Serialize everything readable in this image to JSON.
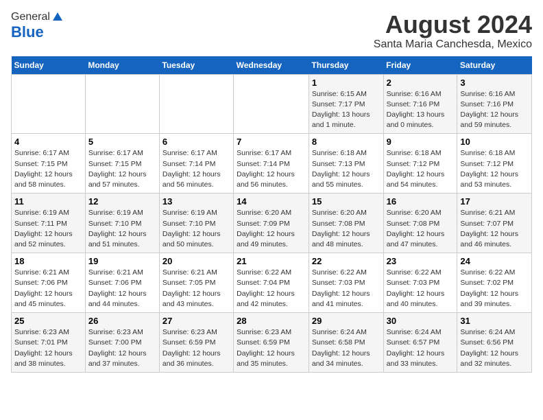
{
  "header": {
    "logo_general": "General",
    "logo_blue": "Blue",
    "month_year": "August 2024",
    "location": "Santa Maria Canchesda, Mexico"
  },
  "days_of_week": [
    "Sunday",
    "Monday",
    "Tuesday",
    "Wednesday",
    "Thursday",
    "Friday",
    "Saturday"
  ],
  "weeks": [
    [
      {
        "day": "",
        "info": ""
      },
      {
        "day": "",
        "info": ""
      },
      {
        "day": "",
        "info": ""
      },
      {
        "day": "",
        "info": ""
      },
      {
        "day": "1",
        "info": "Sunrise: 6:15 AM\nSunset: 7:17 PM\nDaylight: 13 hours\nand 1 minute."
      },
      {
        "day": "2",
        "info": "Sunrise: 6:16 AM\nSunset: 7:16 PM\nDaylight: 13 hours\nand 0 minutes."
      },
      {
        "day": "3",
        "info": "Sunrise: 6:16 AM\nSunset: 7:16 PM\nDaylight: 12 hours\nand 59 minutes."
      }
    ],
    [
      {
        "day": "4",
        "info": "Sunrise: 6:17 AM\nSunset: 7:15 PM\nDaylight: 12 hours\nand 58 minutes."
      },
      {
        "day": "5",
        "info": "Sunrise: 6:17 AM\nSunset: 7:15 PM\nDaylight: 12 hours\nand 57 minutes."
      },
      {
        "day": "6",
        "info": "Sunrise: 6:17 AM\nSunset: 7:14 PM\nDaylight: 12 hours\nand 56 minutes."
      },
      {
        "day": "7",
        "info": "Sunrise: 6:17 AM\nSunset: 7:14 PM\nDaylight: 12 hours\nand 56 minutes."
      },
      {
        "day": "8",
        "info": "Sunrise: 6:18 AM\nSunset: 7:13 PM\nDaylight: 12 hours\nand 55 minutes."
      },
      {
        "day": "9",
        "info": "Sunrise: 6:18 AM\nSunset: 7:12 PM\nDaylight: 12 hours\nand 54 minutes."
      },
      {
        "day": "10",
        "info": "Sunrise: 6:18 AM\nSunset: 7:12 PM\nDaylight: 12 hours\nand 53 minutes."
      }
    ],
    [
      {
        "day": "11",
        "info": "Sunrise: 6:19 AM\nSunset: 7:11 PM\nDaylight: 12 hours\nand 52 minutes."
      },
      {
        "day": "12",
        "info": "Sunrise: 6:19 AM\nSunset: 7:10 PM\nDaylight: 12 hours\nand 51 minutes."
      },
      {
        "day": "13",
        "info": "Sunrise: 6:19 AM\nSunset: 7:10 PM\nDaylight: 12 hours\nand 50 minutes."
      },
      {
        "day": "14",
        "info": "Sunrise: 6:20 AM\nSunset: 7:09 PM\nDaylight: 12 hours\nand 49 minutes."
      },
      {
        "day": "15",
        "info": "Sunrise: 6:20 AM\nSunset: 7:08 PM\nDaylight: 12 hours\nand 48 minutes."
      },
      {
        "day": "16",
        "info": "Sunrise: 6:20 AM\nSunset: 7:08 PM\nDaylight: 12 hours\nand 47 minutes."
      },
      {
        "day": "17",
        "info": "Sunrise: 6:21 AM\nSunset: 7:07 PM\nDaylight: 12 hours\nand 46 minutes."
      }
    ],
    [
      {
        "day": "18",
        "info": "Sunrise: 6:21 AM\nSunset: 7:06 PM\nDaylight: 12 hours\nand 45 minutes."
      },
      {
        "day": "19",
        "info": "Sunrise: 6:21 AM\nSunset: 7:06 PM\nDaylight: 12 hours\nand 44 minutes."
      },
      {
        "day": "20",
        "info": "Sunrise: 6:21 AM\nSunset: 7:05 PM\nDaylight: 12 hours\nand 43 minutes."
      },
      {
        "day": "21",
        "info": "Sunrise: 6:22 AM\nSunset: 7:04 PM\nDaylight: 12 hours\nand 42 minutes."
      },
      {
        "day": "22",
        "info": "Sunrise: 6:22 AM\nSunset: 7:03 PM\nDaylight: 12 hours\nand 41 minutes."
      },
      {
        "day": "23",
        "info": "Sunrise: 6:22 AM\nSunset: 7:03 PM\nDaylight: 12 hours\nand 40 minutes."
      },
      {
        "day": "24",
        "info": "Sunrise: 6:22 AM\nSunset: 7:02 PM\nDaylight: 12 hours\nand 39 minutes."
      }
    ],
    [
      {
        "day": "25",
        "info": "Sunrise: 6:23 AM\nSunset: 7:01 PM\nDaylight: 12 hours\nand 38 minutes."
      },
      {
        "day": "26",
        "info": "Sunrise: 6:23 AM\nSunset: 7:00 PM\nDaylight: 12 hours\nand 37 minutes."
      },
      {
        "day": "27",
        "info": "Sunrise: 6:23 AM\nSunset: 6:59 PM\nDaylight: 12 hours\nand 36 minutes."
      },
      {
        "day": "28",
        "info": "Sunrise: 6:23 AM\nSunset: 6:59 PM\nDaylight: 12 hours\nand 35 minutes."
      },
      {
        "day": "29",
        "info": "Sunrise: 6:24 AM\nSunset: 6:58 PM\nDaylight: 12 hours\nand 34 minutes."
      },
      {
        "day": "30",
        "info": "Sunrise: 6:24 AM\nSunset: 6:57 PM\nDaylight: 12 hours\nand 33 minutes."
      },
      {
        "day": "31",
        "info": "Sunrise: 6:24 AM\nSunset: 6:56 PM\nDaylight: 12 hours\nand 32 minutes."
      }
    ]
  ]
}
